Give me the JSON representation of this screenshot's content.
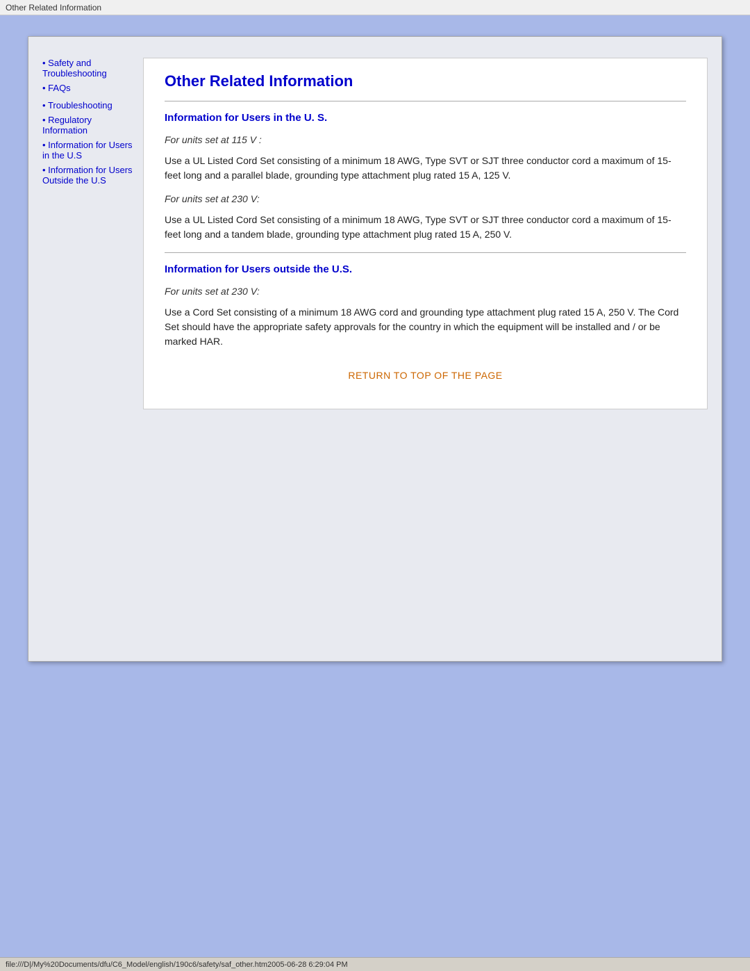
{
  "title_bar": {
    "text": "Other Related Information"
  },
  "sidebar": {
    "items": [
      {
        "id": "safety-troubleshooting",
        "label": "Safety and Troubleshooting",
        "bullet": "•",
        "indent": false
      },
      {
        "id": "faqs",
        "label": "FAQs",
        "bullet": "•",
        "indent": false
      },
      {
        "id": "troubleshooting",
        "label": "Troubleshooting",
        "bullet": "•",
        "indent": false
      },
      {
        "id": "regulatory-info",
        "label": "Regulatory Information",
        "bullet": "•",
        "indent": false
      },
      {
        "id": "info-users-us",
        "label": "Information for Users in the U.S",
        "bullet": "•",
        "indent": false
      },
      {
        "id": "info-users-outside-us",
        "label": "Information for Users Outside the U.S",
        "bullet": "•",
        "indent": false
      }
    ]
  },
  "main": {
    "page_title": "Other Related Information",
    "section1": {
      "title": "Information for Users in the U. S.",
      "subsection1": {
        "italic": "For units set at 115 V :",
        "body": "Use a UL Listed Cord Set consisting of a minimum 18 AWG, Type SVT or SJT three conductor cord a maximum of 15-feet long and a parallel blade, grounding type attachment plug rated 15 A, 125 V."
      },
      "subsection2": {
        "italic": "For units set at 230 V:",
        "body": "Use a UL Listed Cord Set consisting of a minimum 18 AWG, Type SVT or SJT three conductor cord a maximum of 15-feet long and a tandem blade, grounding type attachment plug rated 15 A, 250 V."
      }
    },
    "section2": {
      "title": "Information for Users outside the U.S.",
      "subsection1": {
        "italic": "For units set at 230 V:",
        "body": "Use a Cord Set consisting of a minimum 18 AWG cord and grounding type attachment plug rated 15 A, 250 V. The Cord Set should have the appropriate safety approvals for the country in which the equipment will be installed and / or be marked HAR."
      }
    },
    "return_link": "RETURN TO TOP OF THE PAGE"
  },
  "status_bar": {
    "text": "file:///D|/My%20Documents/dfu/C6_Model/english/190c6/safety/saf_other.htm2005-06-28  6:29:04 PM"
  }
}
